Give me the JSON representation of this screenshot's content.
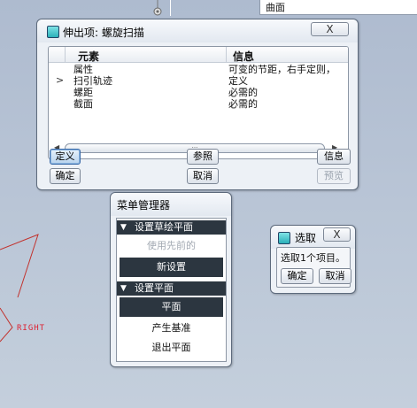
{
  "top_bar": {
    "field_value": "曲面"
  },
  "viewport": {
    "datum_label": "RIGHT"
  },
  "main_dialog": {
    "title": "伸出项: 螺旋扫描",
    "close_label": "X",
    "columns": {
      "element": "元素",
      "info": "信息"
    },
    "rows": [
      {
        "element": "属性",
        "info": "可变的节距，右手定则，",
        "current": false
      },
      {
        "element": "扫引轨迹",
        "info": "定义",
        "current": true
      },
      {
        "element": "螺距",
        "info": "必需的",
        "current": false
      },
      {
        "element": "截面",
        "info": "必需的",
        "current": false
      }
    ],
    "current_marker": ">",
    "buttons": {
      "define": "定义",
      "reference": "参照",
      "info": "信息",
      "ok": "确定",
      "cancel": "取消",
      "preview": "预览"
    }
  },
  "menu_manager": {
    "title": "菜单管理器",
    "section1": "设置草绘平面",
    "section1_items": [
      {
        "label": "使用先前的",
        "state": "disabled"
      },
      {
        "label": "新设置",
        "state": "selected"
      }
    ],
    "section2": "设置平面",
    "section2_items": [
      {
        "label": "平面",
        "state": "selected"
      },
      {
        "label": "产生基准",
        "state": "normal"
      },
      {
        "label": "退出平面",
        "state": "normal"
      }
    ]
  },
  "select_dialog": {
    "title": "选取",
    "close_label": "X",
    "message": "选取1个项目。",
    "ok": "确定",
    "cancel": "取消"
  },
  "colors": {
    "background": "#b5c2d3",
    "menu_highlight": "#2c3640",
    "active_button": "#b8d3ee"
  }
}
